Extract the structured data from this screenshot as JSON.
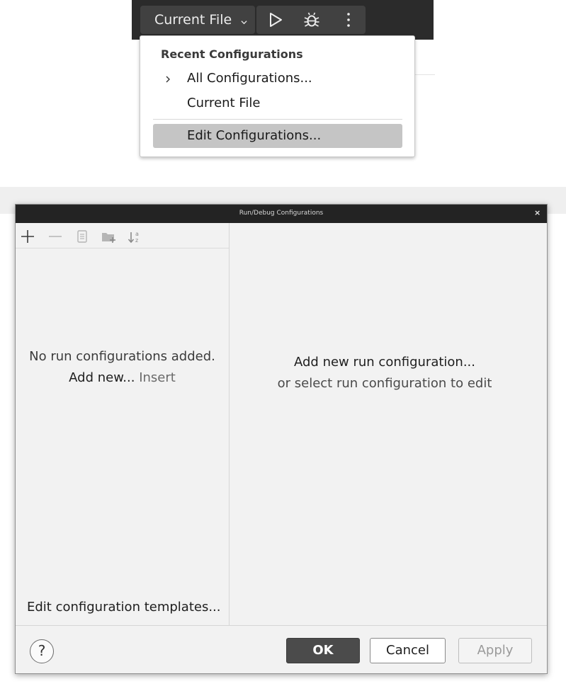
{
  "toolbar": {
    "config_label": "Current File",
    "icons": [
      "chevron-down-icon",
      "run-icon",
      "debug-icon",
      "more-vertical-icon"
    ]
  },
  "popup": {
    "header": "Recent Configurations",
    "items": [
      {
        "label": "All Configurations...",
        "icon": "chevron-right-icon"
      },
      {
        "label": "Current File"
      },
      {
        "label": "Edit Configurations...",
        "state": "highlighted"
      }
    ]
  },
  "dialog": {
    "title": "Run/Debug Configurations",
    "close_glyph": "×",
    "left_toolbar_icons": [
      "add-icon",
      "remove-icon",
      "copy-icon",
      "new-folder-icon",
      "sort-alpha-icon"
    ],
    "left_pane": {
      "empty_message": "No run configurations added.",
      "add_new_link": "Add new...",
      "add_new_shortcut": "Insert",
      "templates_link": "Edit configuration templates..."
    },
    "right_pane": {
      "line1": "Add new run configuration...",
      "line2": "or select run configuration to edit"
    },
    "buttons": {
      "help": "?",
      "ok": "OK",
      "cancel": "Cancel",
      "apply": "Apply"
    }
  },
  "colors": {
    "toolbar_bg": "#2b2b2b",
    "highlight": "#c5c5c5",
    "titlebar_bg": "#232323",
    "primary_button": "#4b4b4b"
  }
}
